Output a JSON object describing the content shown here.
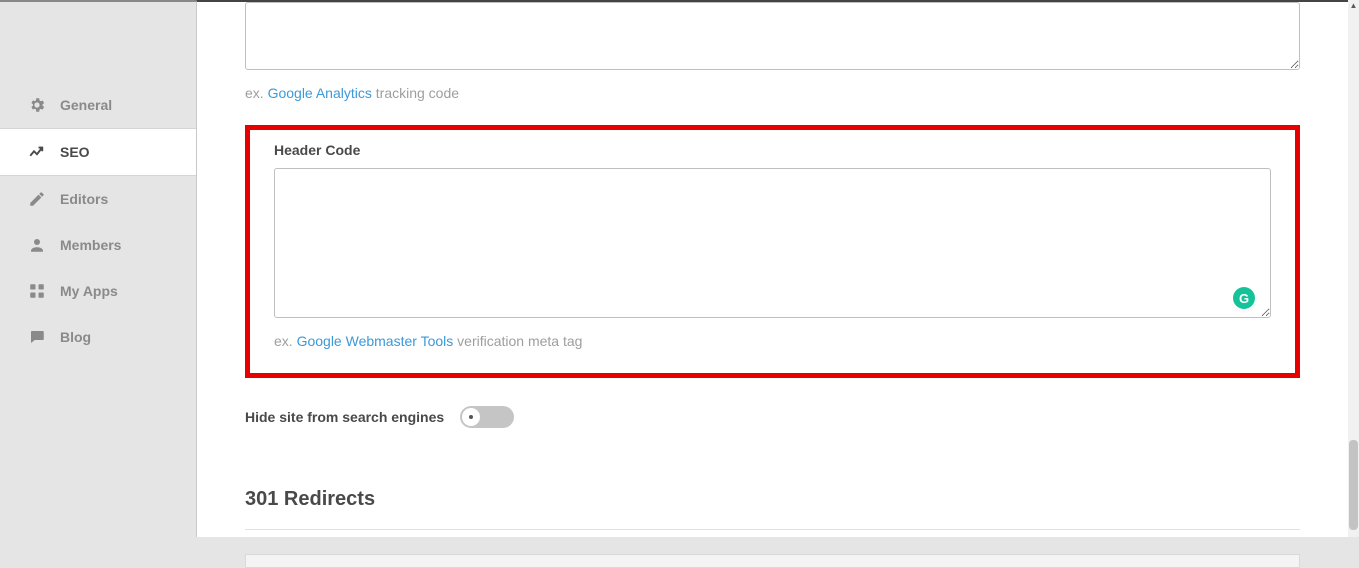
{
  "sidebar": {
    "items": [
      {
        "label": "General",
        "icon": "gear-icon"
      },
      {
        "label": "SEO",
        "icon": "trend-icon"
      },
      {
        "label": "Editors",
        "icon": "pencil-icon"
      },
      {
        "label": "Members",
        "icon": "person-icon"
      },
      {
        "label": "My Apps",
        "icon": "apps-icon"
      },
      {
        "label": "Blog",
        "icon": "chat-icon"
      }
    ]
  },
  "main": {
    "hint1_prefix": "ex. ",
    "hint1_link": "Google Analytics",
    "hint1_suffix": " tracking code",
    "header_code_label": "Header Code",
    "header_code_value": "",
    "hint2_prefix": "ex. ",
    "hint2_link": "Google Webmaster Tools",
    "hint2_suffix": " verification meta tag",
    "hide_label": "Hide site from search engines",
    "redirects_title": "301 Redirects",
    "grammarly_glyph": "G"
  }
}
